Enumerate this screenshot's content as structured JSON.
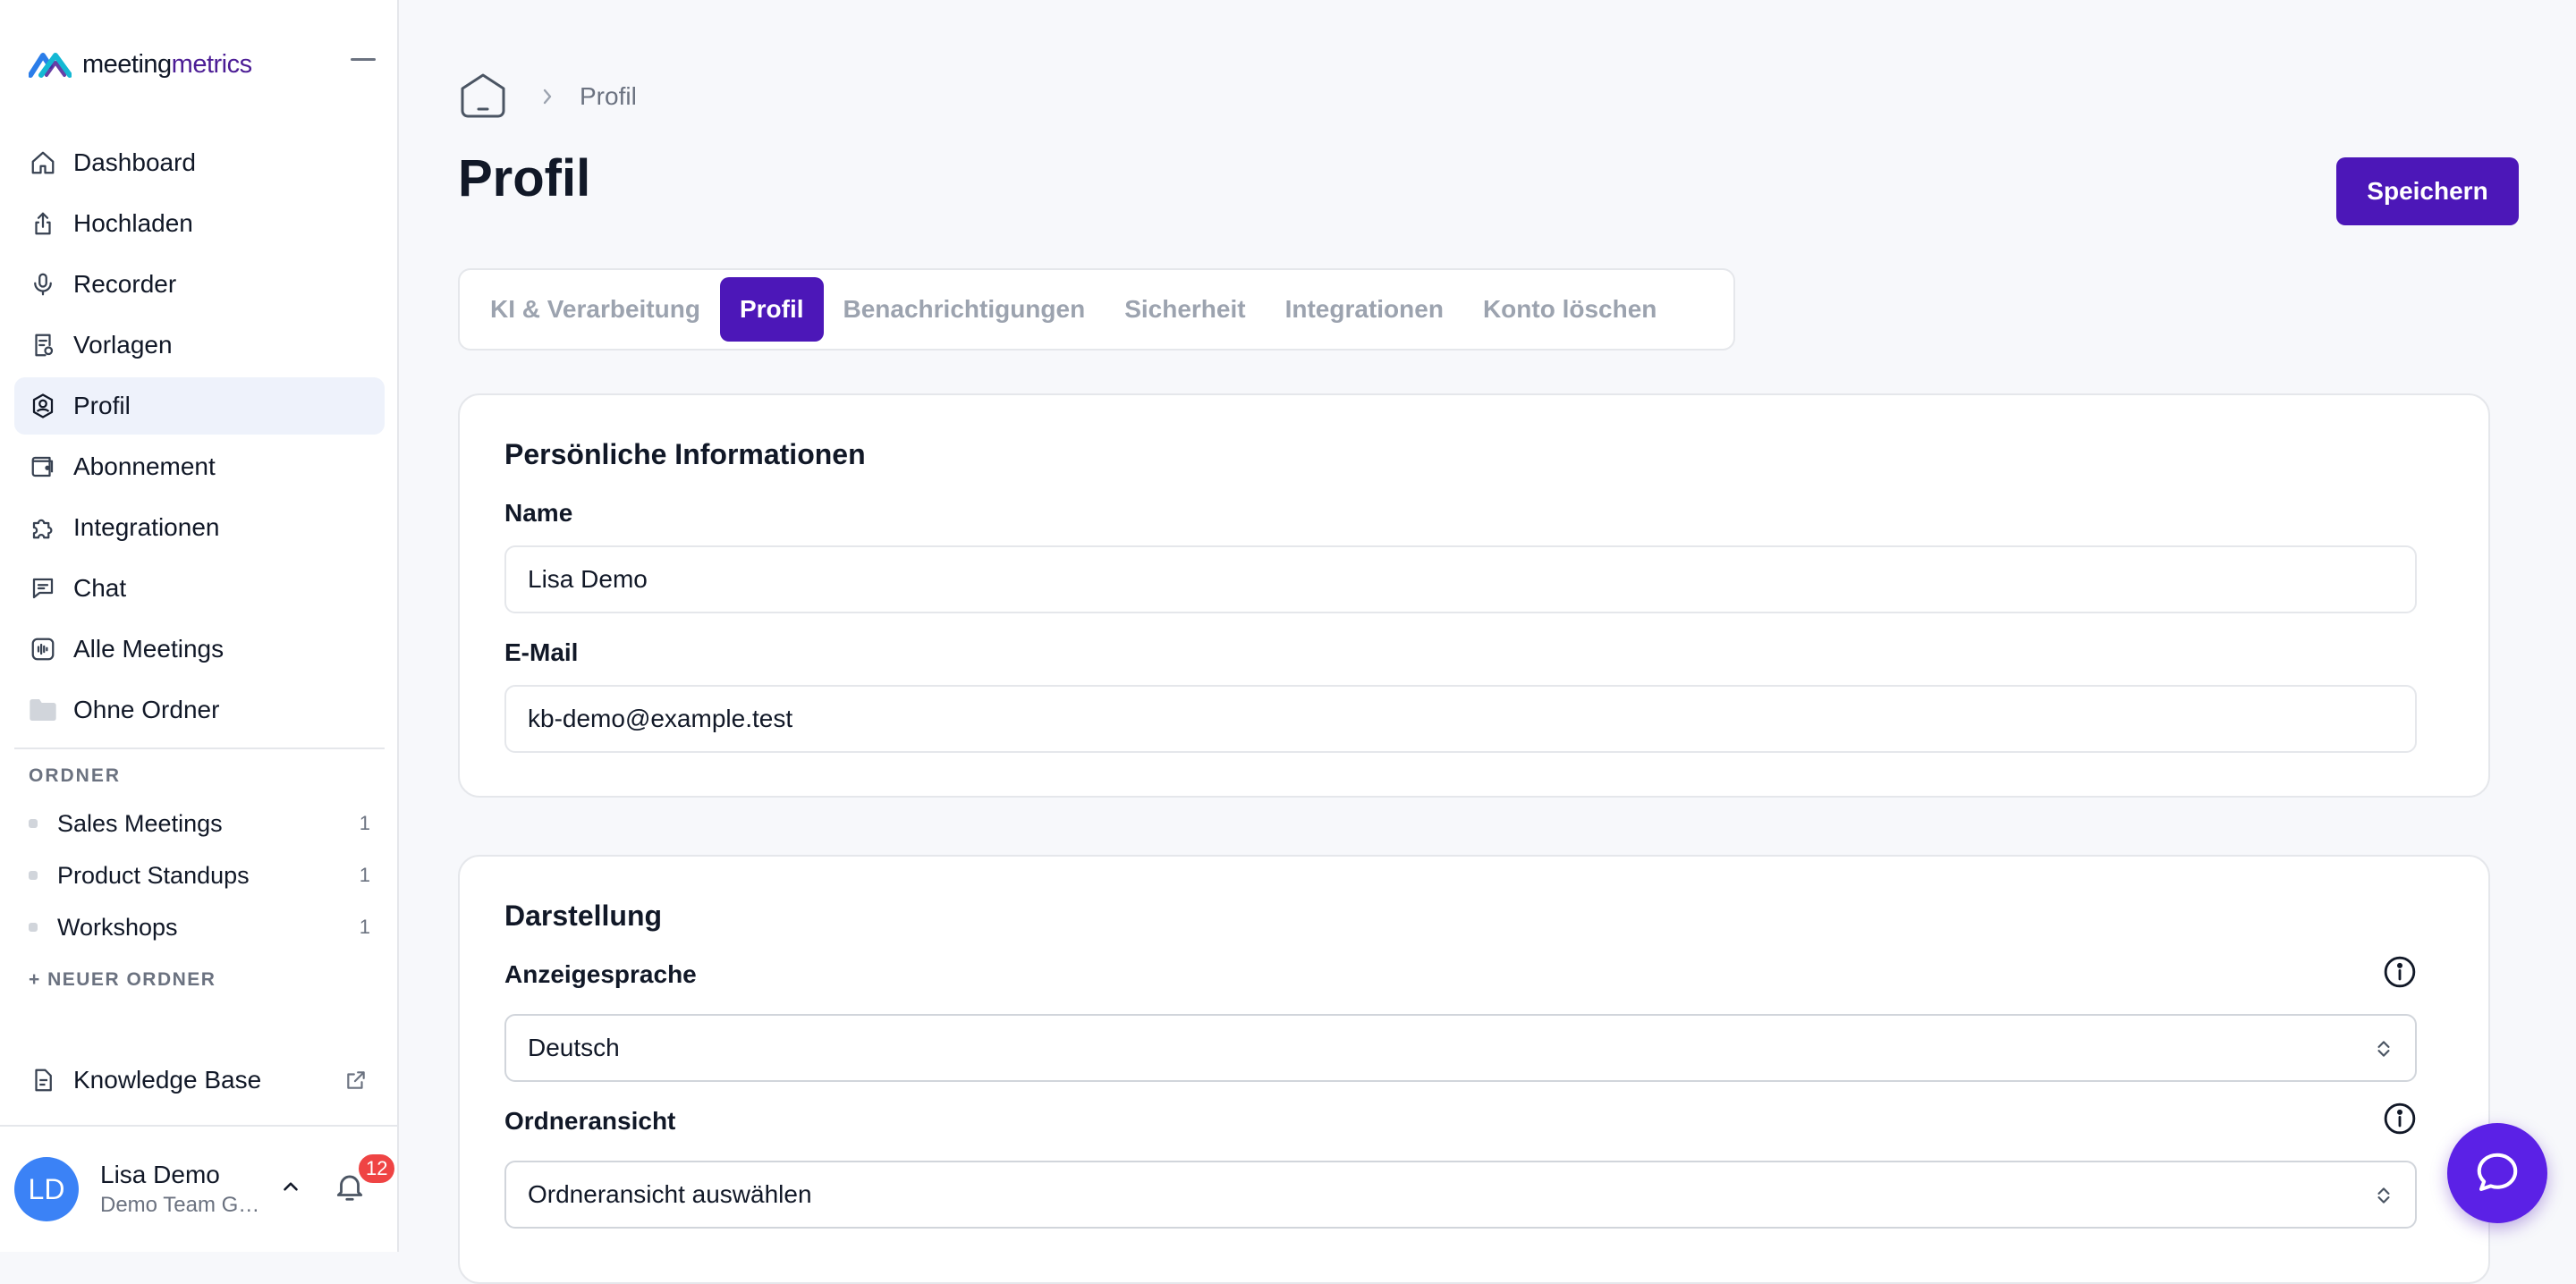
{
  "brand": {
    "name_part1": "meeting",
    "name_part2": "metrics",
    "accent_color": "#4c17b8"
  },
  "sidebar": {
    "nav": [
      {
        "label": "Dashboard",
        "icon": "home-icon"
      },
      {
        "label": "Hochladen",
        "icon": "upload-icon"
      },
      {
        "label": "Recorder",
        "icon": "microphone-icon"
      },
      {
        "label": "Vorlagen",
        "icon": "template-icon"
      },
      {
        "label": "Profil",
        "icon": "profile-settings-icon"
      },
      {
        "label": "Abonnement",
        "icon": "wallet-icon"
      },
      {
        "label": "Integrationen",
        "icon": "puzzle-icon"
      },
      {
        "label": "Chat",
        "icon": "chat-icon"
      },
      {
        "label": "Alle Meetings",
        "icon": "waveform-icon"
      },
      {
        "label": "Ohne Ordner",
        "icon": "folder-icon"
      }
    ],
    "folders_label": "ORDNER",
    "folders": [
      {
        "name": "Sales Meetings",
        "count": "1"
      },
      {
        "name": "Product Standups",
        "count": "1"
      },
      {
        "name": "Workshops",
        "count": "1"
      }
    ],
    "new_folder_label": "+ NEUER ORDNER",
    "knowledge_base_label": "Knowledge Base",
    "user": {
      "initials": "LD",
      "name": "Lisa Demo",
      "team": "Demo Team GmbH",
      "notification_count": "12"
    }
  },
  "breadcrumb": {
    "current": "Profil"
  },
  "page": {
    "title": "Profil",
    "save_label": "Speichern"
  },
  "tabs": [
    {
      "label": "KI & Verarbeitung",
      "active": false
    },
    {
      "label": "Profil",
      "active": true
    },
    {
      "label": "Benachrichtigungen",
      "active": false
    },
    {
      "label": "Sicherheit",
      "active": false
    },
    {
      "label": "Integrationen",
      "active": false
    },
    {
      "label": "Konto löschen",
      "active": false
    }
  ],
  "personal": {
    "title": "Persönliche Informationen",
    "name_label": "Name",
    "name_value": "Lisa Demo",
    "email_label": "E-Mail",
    "email_value": "kb-demo@example.test"
  },
  "appearance": {
    "title": "Darstellung",
    "language_label": "Anzeigesprache",
    "language_value": "Deutsch",
    "folder_view_label": "Ordneransicht",
    "folder_view_placeholder": "Ordneransicht auswählen"
  }
}
